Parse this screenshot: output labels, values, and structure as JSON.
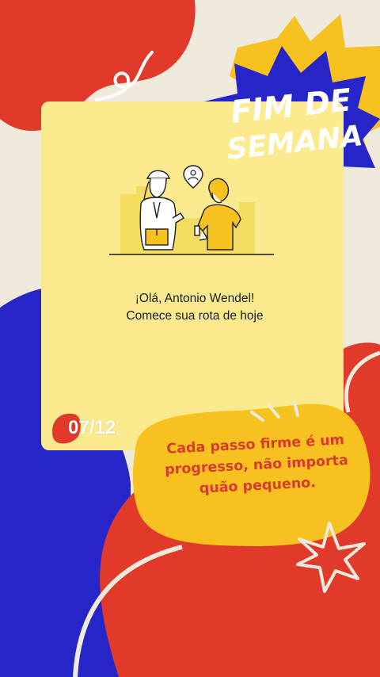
{
  "badge": {
    "line1": "FIM DE",
    "line2": "SEMANA"
  },
  "greeting": {
    "line1": "¡Olá, Antonio Wendel!",
    "line2": "Comece sua rota de hoje"
  },
  "date_label": "07/12",
  "quote": "Cada passo firme é um progresso, não importa quão pequeno.",
  "colors": {
    "background": "#efeadc",
    "red": "#e13a2b",
    "blue": "#2626c8",
    "yellow": "#f7c21f",
    "card": "#fbeb8e"
  }
}
